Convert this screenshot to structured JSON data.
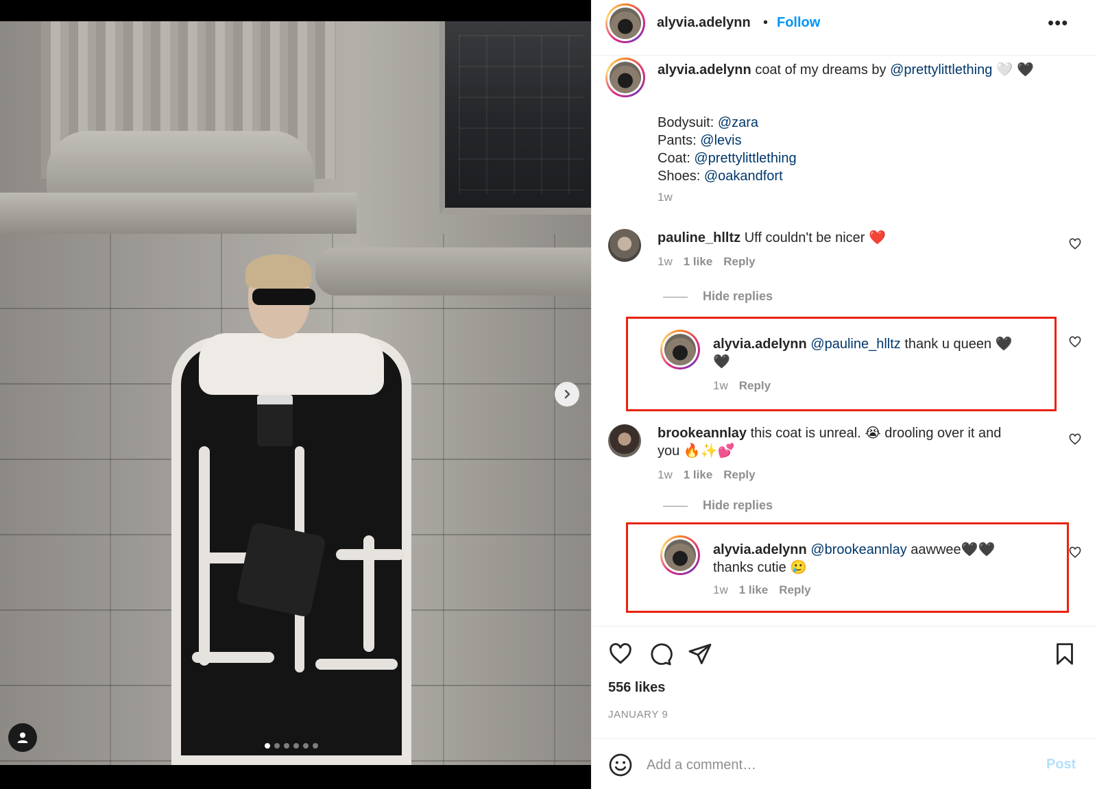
{
  "post": {
    "author": "alyvia.adelynn",
    "separator": "•",
    "follow_label": "Follow",
    "more_label": "•••",
    "caption": {
      "author": "alyvia.adelynn",
      "text_before": "coat of my dreams by",
      "mention": "@prettylittlething",
      "emoji_after": "🤍 🖤",
      "lines": [
        {
          "label": "Bodysuit:",
          "mention": "@zara"
        },
        {
          "label": "Pants:",
          "mention": "@levis"
        },
        {
          "label": "Coat:",
          "mention": "@prettylittlething"
        },
        {
          "label": "Shoes:",
          "mention": "@oakandfort"
        }
      ],
      "time": "1w"
    },
    "comments": [
      {
        "author": "pauline_hlltz",
        "text": "Uff couldn't be nicer ❤️",
        "time": "1w",
        "likes": "1 like",
        "reply_label": "Reply",
        "hide_replies": "Hide replies",
        "reply": {
          "author": "alyvia.adelynn",
          "mention": "@pauline_hlltz",
          "text": "thank u queen 🖤",
          "text2": "🖤",
          "time": "1w",
          "reply_label": "Reply"
        }
      },
      {
        "author": "brookeannlay",
        "text": "this coat is unreal. 😭 drooling over it and",
        "text2": "you 🔥✨💕",
        "time": "1w",
        "likes": "1 like",
        "reply_label": "Reply",
        "hide_replies": "Hide replies",
        "reply": {
          "author": "alyvia.adelynn",
          "mention": "@brookeannlay",
          "text": "aawwee🖤🖤",
          "text2": "thanks cutie 🥲",
          "time": "1w",
          "likes": "1 like",
          "reply_label": "Reply"
        }
      }
    ],
    "likes": "556 likes",
    "date": "JANUARY 9",
    "comment_placeholder": "Add a comment…",
    "post_label": "Post"
  },
  "media": {
    "carousel_total": 6,
    "carousel_active": 0
  },
  "colors": {
    "link": "#0095f6",
    "mention": "#00376b",
    "highlight": "#e8220f",
    "muted": "#8e8e8e"
  },
  "icons": [
    "next-arrow-icon",
    "user-tag-icon",
    "more-icon",
    "heart-icon",
    "comment-icon",
    "share-icon",
    "bookmark-icon",
    "emoji-icon"
  ]
}
